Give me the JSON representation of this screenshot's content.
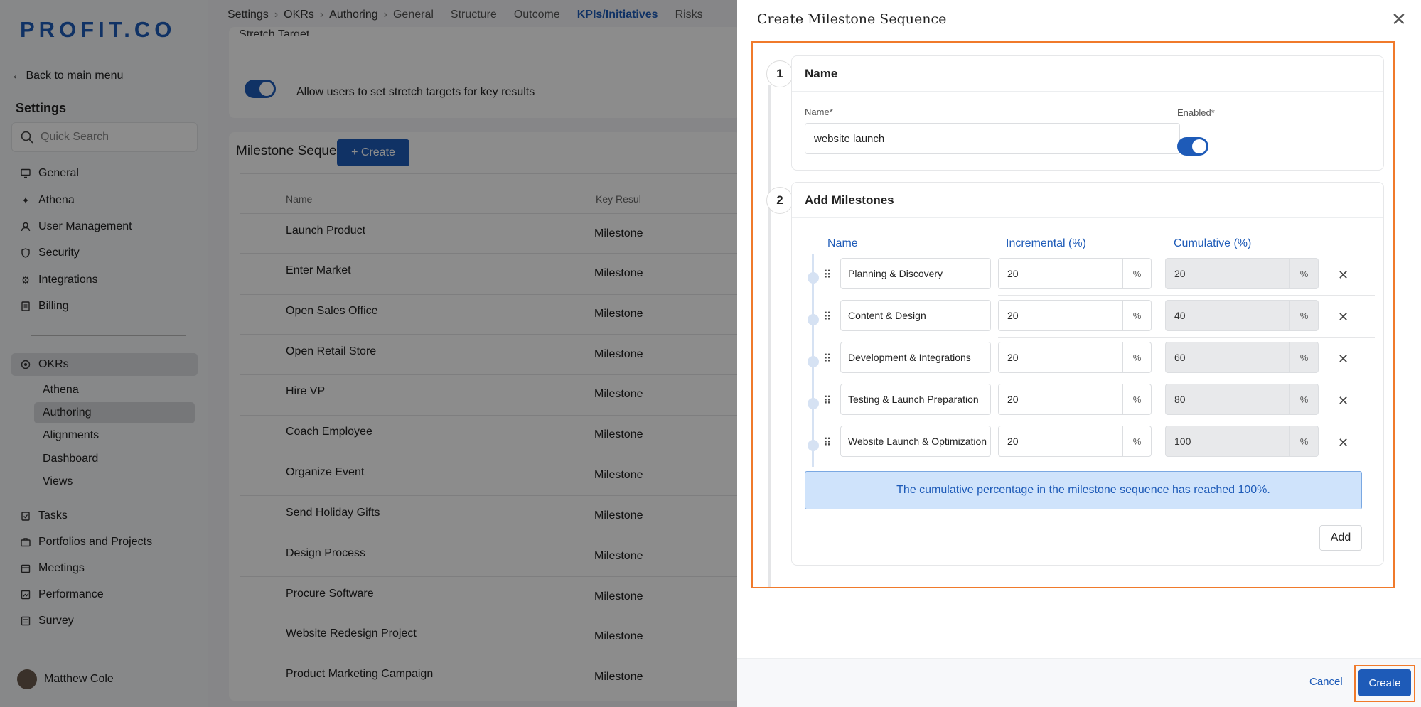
{
  "brand": {
    "logo": "PROFIT.CO",
    "accent": "#1e5bb8",
    "highlight": "#f07a2b"
  },
  "sidebar": {
    "back_link": "Back to main menu",
    "heading": "Settings",
    "search_placeholder": "Quick Search",
    "items": [
      {
        "label": "General",
        "icon": "monitor-icon"
      },
      {
        "label": "Athena",
        "icon": "sparkle-icon"
      },
      {
        "label": "User Management",
        "icon": "user-icon"
      },
      {
        "label": "Security",
        "icon": "shield-icon"
      },
      {
        "label": "Integrations",
        "icon": "gear-icon"
      },
      {
        "label": "Billing",
        "icon": "receipt-icon"
      }
    ],
    "okrs": {
      "label": "OKRs",
      "icon": "target-icon",
      "children": [
        "Athena",
        "Authoring",
        "Alignments",
        "Dashboard",
        "Views"
      ]
    },
    "items2": [
      {
        "label": "Tasks",
        "icon": "clipboard-icon"
      },
      {
        "label": "Portfolios and Projects",
        "icon": "briefcase-icon"
      },
      {
        "label": "Meetings",
        "icon": "calendar-icon"
      },
      {
        "label": "Performance",
        "icon": "chart-icon"
      },
      {
        "label": "Survey",
        "icon": "survey-icon"
      }
    ],
    "user": "Matthew Cole"
  },
  "main": {
    "breadcrumb": [
      "Settings",
      "OKRs",
      "Authoring"
    ],
    "tabs": [
      "General",
      "Structure",
      "Outcome",
      "KPIs/Initiatives",
      "Risks"
    ],
    "active_tab": "KPIs/Initiatives",
    "card_cut_title": "Stretch Target",
    "stretch_label": "Allow users to set stretch targets for key results",
    "milestone_title": "Milestone Sequence",
    "create_btn": "+ Create",
    "col_name": "Name",
    "col_key": "Key Resul",
    "rows": [
      {
        "name": "Launch Product",
        "key": "Milestone"
      },
      {
        "name": "Enter Market",
        "key": "Milestone"
      },
      {
        "name": "Open Sales Office",
        "key": "Milestone"
      },
      {
        "name": "Open Retail Store",
        "key": "Milestone"
      },
      {
        "name": "Hire VP",
        "key": "Milestone"
      },
      {
        "name": "Coach Employee",
        "key": "Milestone"
      },
      {
        "name": "Organize Event",
        "key": "Milestone"
      },
      {
        "name": "Send Holiday Gifts",
        "key": "Milestone"
      },
      {
        "name": "Design Process",
        "key": "Milestone"
      },
      {
        "name": "Procure Software",
        "key": "Milestone"
      },
      {
        "name": "Website Redesign Project",
        "key": "Milestone"
      },
      {
        "name": "Product Marketing Campaign",
        "key": "Milestone"
      }
    ]
  },
  "drawer": {
    "title": "Create Milestone Sequence",
    "step1": {
      "num": "1",
      "title": "Name",
      "name_label": "Name",
      "enabled_label": "Enabled",
      "required_mark": "*",
      "name_value": "website launch",
      "enabled": true
    },
    "step2": {
      "num": "2",
      "title": "Add Milestones",
      "col_name": "Name",
      "col_inc": "Incremental (%)",
      "col_cum": "Cumulative (%)",
      "unit": "%",
      "milestones": [
        {
          "name": "Planning & Discovery",
          "inc": "20",
          "cum": "20"
        },
        {
          "name": "Content & Design",
          "inc": "20",
          "cum": "40"
        },
        {
          "name": "Development & Integrations",
          "inc": "20",
          "cum": "60"
        },
        {
          "name": "Testing & Launch Preparation",
          "inc": "20",
          "cum": "80"
        },
        {
          "name": "Website Launch & Optimization",
          "inc": "20",
          "cum": "100"
        }
      ],
      "info": "The cumulative percentage in the milestone sequence has reached 100%.",
      "add_btn": "Add"
    },
    "cancel": "Cancel",
    "create": "Create"
  }
}
